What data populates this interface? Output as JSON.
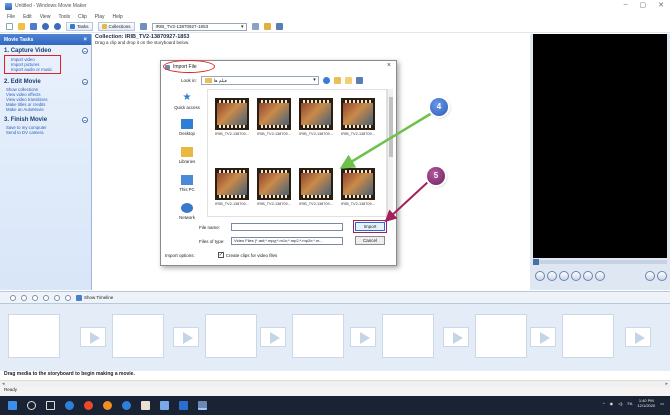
{
  "window": {
    "title": "Untitled - Windows Movie Maker",
    "controls": [
      "–",
      "▢",
      "✕"
    ]
  },
  "menu": [
    "File",
    "Edit",
    "View",
    "Tools",
    "Clip",
    "Play",
    "Help"
  ],
  "toolbar": {
    "tasks_label": "Tasks",
    "collections_label": "Collections",
    "collection_combo": "IRIB_TV2-13870927-1853"
  },
  "taskpane": {
    "header": "Movie Tasks",
    "sections": [
      {
        "number": "1.",
        "title": "Capture Video",
        "links": [
          "Import video",
          "Import pictures",
          "Import audio or music"
        ]
      },
      {
        "number": "2.",
        "title": "Edit Movie",
        "links": [
          "Show collections",
          "View video effects",
          "View video transitions",
          "Make titles or credits",
          "Make an AutoMovie"
        ]
      },
      {
        "number": "3.",
        "title": "Finish Movie",
        "links": [
          "Save to my computer",
          "Send to DV camera"
        ]
      }
    ]
  },
  "collection": {
    "title": "Collection: IRIB_TV2-13870927-1853",
    "hint": "Drag a clip and drop it on the storyboard below."
  },
  "dialog": {
    "title": "Import File",
    "look_in_label": "Look in:",
    "look_in_value": "فیلم ها",
    "nav": [
      "Quick access",
      "Desktop",
      "Libraries",
      "This PC",
      "Network"
    ],
    "files": [
      "IRIB_TV2-138709...",
      "IRIB_TV2-138709...",
      "IRIB_TV2-138709...",
      "IRIB_TV2-138709...",
      "IRIB_TV2-138709...",
      "IRIB_TV2-138709...",
      "IRIB_TV2-138709...",
      "IRIB_TV2-138709..."
    ],
    "file_name_label": "File name:",
    "file_name_value": "",
    "file_type_label": "Files of type:",
    "file_type_value": "Video Files (*.asf;*.mpg;*.m1v;*.mp2;*.mp2v;*.m...",
    "import_button": "Import",
    "cancel_button": "Cancel",
    "options_label": "Import options:",
    "create_clips_label": "Create clips for video files",
    "create_clips_checked": true
  },
  "storyboard": {
    "show_timeline": "Show Timeline",
    "status": "Drag media to the storyboard to begin making a movie.",
    "ready": "Ready"
  },
  "annotations": [
    "4",
    "5"
  ],
  "tray": {
    "time": "1:40 PM",
    "date": "12/1/2020",
    "lang": "FA"
  },
  "colors": {
    "taskpane_header": "#3266c0",
    "annotation_red": "#dd2222",
    "annotation_blue": "#2a5ab8",
    "annotation_purple": "#6a1f5e",
    "arrow_green": "#6cc24a",
    "taskbar": "#1a2333"
  }
}
